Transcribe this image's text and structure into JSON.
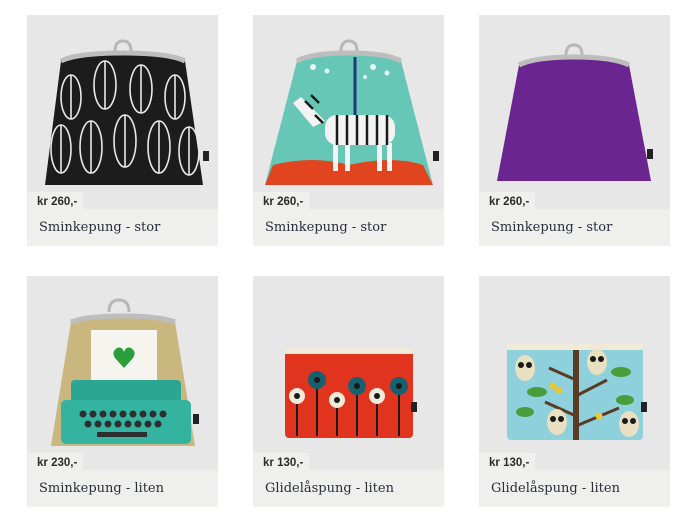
{
  "products": [
    {
      "price": "kr 260,-",
      "title": "Sminkepung - stor",
      "pattern": "leaves",
      "colors": {
        "bg": "#1c1c1c",
        "accent": "#e9e9e9"
      }
    },
    {
      "price": "kr 260,-",
      "title": "Sminkepung - stor",
      "pattern": "zebra",
      "colors": {
        "bg": "#67c7b7",
        "accent": "#e0451f"
      }
    },
    {
      "price": "kr 260,-",
      "title": "Sminkepung - stor",
      "pattern": "plain-purple",
      "colors": {
        "bg": "#6a2591",
        "accent": "#7c35a3"
      }
    },
    {
      "price": "kr 230,-",
      "title": "Sminkepung - liten",
      "pattern": "typewriter",
      "colors": {
        "bg": "#c9b77f",
        "accent": "#2aa693"
      }
    },
    {
      "price": "kr 130,-",
      "title": "Glidelåspung - liten",
      "pattern": "flowers",
      "colors": {
        "bg": "#e0341f",
        "accent": "#17606e"
      }
    },
    {
      "price": "kr 130,-",
      "title": "Glidelåspung - liten",
      "pattern": "owls",
      "colors": {
        "bg": "#8fd0dd",
        "accent": "#5a3b23"
      }
    }
  ]
}
